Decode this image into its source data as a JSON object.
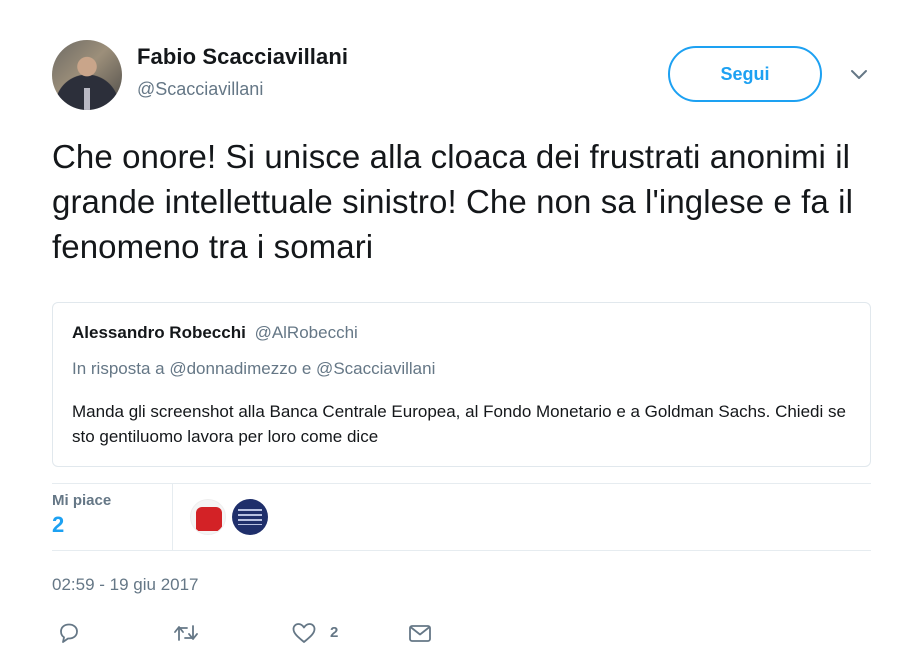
{
  "author": {
    "name": "Fabio Scacciavillani",
    "handle": "@Scacciavillani"
  },
  "follow_button": {
    "label": "Segui"
  },
  "tweet": {
    "text": "Che onore! Si unisce alla cloaca dei frustrati anonimi il grande intellettuale sinistro! Che non sa l'inglese e fa il fenomeno tra i somari"
  },
  "quoted": {
    "name": "Alessandro Robecchi",
    "handle": "@AlRobecchi",
    "reply_to": "In risposta a @donnadimezzo e @Scacciavillani",
    "text": "Manda gli screenshot alla Banca Centrale Europea, al Fondo Monetario e a Goldman Sachs. Chiedi se sto gentiluomo lavora per loro come dice"
  },
  "stats": {
    "likes_label": "Mi piace",
    "likes_count": "2"
  },
  "timestamp": "02:59 - 19 giu 2017",
  "actions": {
    "like_count": "2"
  },
  "colors": {
    "accent": "#1da1f2",
    "secondary_text": "#657786",
    "primary_text": "#14171a",
    "divider": "#e6ecf0"
  },
  "icons": [
    "reply-icon",
    "retweet-icon",
    "heart-icon",
    "direct-message-icon",
    "chevron-down-icon"
  ]
}
